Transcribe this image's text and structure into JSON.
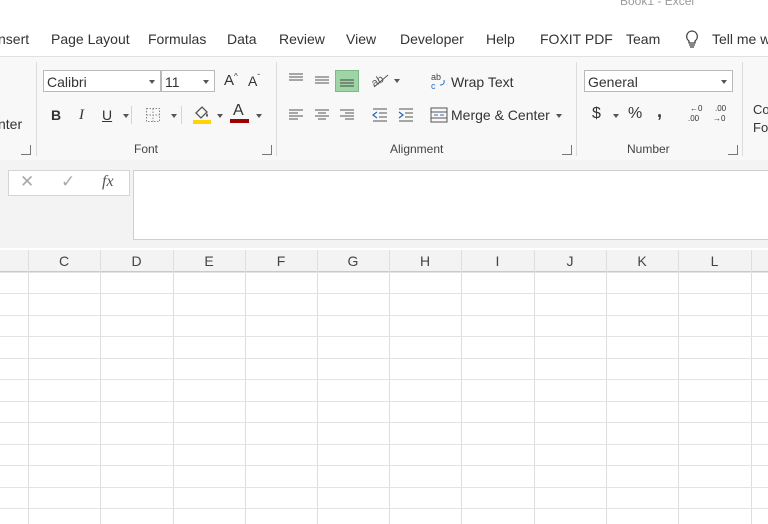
{
  "window": {
    "title": "Book1 - Excel"
  },
  "tabs": [
    "nsert",
    "Page Layout",
    "Formulas",
    "Data",
    "Review",
    "View",
    "Developer",
    "Help",
    "FOXIT PDF",
    "Team",
    "Tell me w"
  ],
  "clipboard": {
    "partial_label": "nter"
  },
  "font": {
    "name": "Calibri",
    "size": "11",
    "bold": "B",
    "italic": "I",
    "underline": "U",
    "grow": "A",
    "shrink": "A",
    "color_letter": "A",
    "group_label": "Font",
    "fill_color": "#ffd400",
    "font_color": "#a00000"
  },
  "alignment": {
    "wrap_text": "Wrap Text",
    "wrap_icon_text": "ab c",
    "merge_center": "Merge & Center",
    "group_label": "Alignment"
  },
  "number": {
    "format": "General",
    "currency": "$",
    "percent": "%",
    "comma": ",",
    "inc_dec": ".00",
    "dec_dec": ".00",
    "group_label": "Number"
  },
  "styles": {
    "partial_line1": "Co",
    "partial_line2": "Fo"
  },
  "formula_bar": {
    "cancel": "✕",
    "enter": "✓",
    "fx": "fx",
    "value": ""
  },
  "columns": [
    "C",
    "D",
    "E",
    "F",
    "G",
    "H",
    "I",
    "J",
    "K",
    "L"
  ]
}
